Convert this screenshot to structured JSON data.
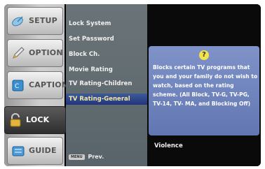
{
  "sidebar": {
    "items": [
      {
        "label": "SETUP",
        "icon": "satellite-dish-icon"
      },
      {
        "label": "OPTION",
        "icon": "pencil-icon"
      },
      {
        "label": "CAPTION",
        "icon": "caption-book-icon"
      },
      {
        "label": "LOCK",
        "icon": "padlock-icon",
        "active": true
      },
      {
        "label": "GUIDE",
        "icon": "guide-book-icon"
      }
    ]
  },
  "menu": {
    "items": [
      {
        "label": "Lock System"
      },
      {
        "label": "Set Password"
      },
      {
        "label": "Block Ch."
      },
      {
        "label": "Movie Rating"
      },
      {
        "label": "TV Rating-Children"
      },
      {
        "label": "TV Rating-General",
        "selected": true
      }
    ],
    "selected_arrow": "▸"
  },
  "footer": {
    "prev_key": "MENU",
    "prev_label": "Prev."
  },
  "help_popup": {
    "icon": "?",
    "text": "Blocks certain TV programs that you and your family do not wish to watch, based on the rating scheme. (All Block, TV-G, TV-PG, TV-14, TV- MA, and Blocking Off)"
  },
  "submenu": {
    "visible_item": "Violence"
  },
  "colors": {
    "menu_bg": "#5e696e",
    "selected_bg": "#2a3f86",
    "selected_text": "#f3e9a0",
    "popup_bg": "#7186c0"
  }
}
